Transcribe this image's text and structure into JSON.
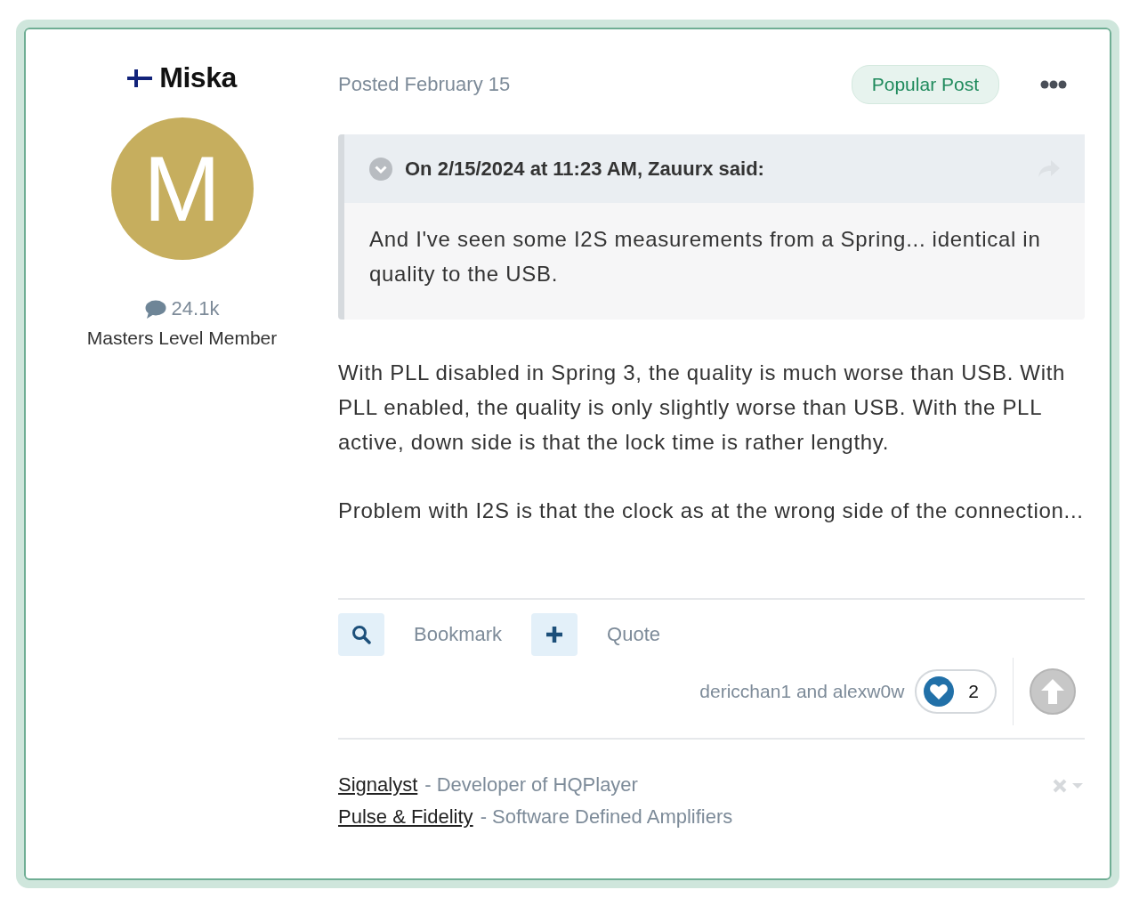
{
  "author": {
    "name": "Miska",
    "avatar_letter": "M",
    "post_count": "24.1k",
    "rank": "Masters Level Member"
  },
  "post": {
    "posted": "Posted February 15",
    "badge": "Popular Post"
  },
  "quote": {
    "header": "On 2/15/2024 at 11:23 AM, Zauurx said:",
    "text": "And I've seen some I2S measurements from a Spring... identical in quality to the USB."
  },
  "paragraphs": [
    "With PLL disabled in Spring 3, the quality is much worse than USB. With PLL enabled, the quality is only slightly worse than USB. With the PLL active, down side is that the lock time is rather lengthy.",
    "Problem with I2S is that the clock as at the wrong side of the connection..."
  ],
  "actions": [
    {
      "kind": "search",
      "label": "Bookmark"
    },
    {
      "kind": "plus",
      "label": "Quote"
    }
  ],
  "reactions": {
    "names": "dericchan1 and alexw0w",
    "count": "2"
  },
  "signature": [
    {
      "link": "Signalyst",
      "text": "- Developer of HQPlayer"
    },
    {
      "link": "Pulse & Fidelity",
      "text": "- Software Defined Amplifiers"
    }
  ]
}
